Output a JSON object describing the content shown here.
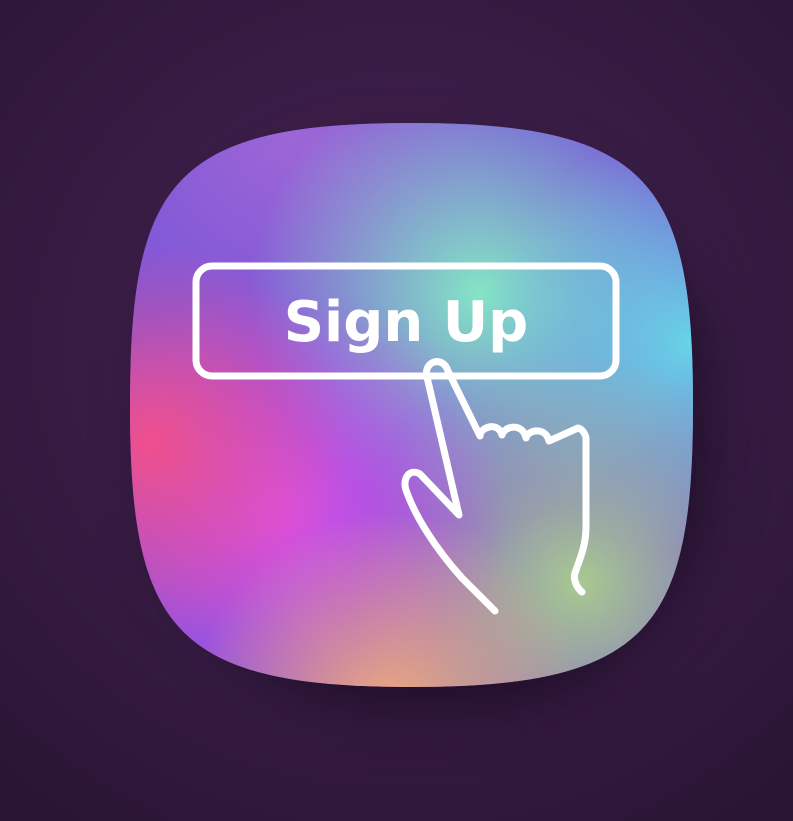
{
  "app_icon": {
    "name": "sign-up-app-icon",
    "button_label": "Sign Up",
    "hand_icon": "pointing-hand-icon",
    "colors": {
      "background": "#3a1d46",
      "magenta": "#d94fe8",
      "pink": "#f04f8c",
      "purple": "#7a55d8",
      "mint": "#84e5c5",
      "cyan": "#67d4e6",
      "lime": "#a8c990",
      "peach": "#f2ad78",
      "line": "#ffffff"
    }
  }
}
